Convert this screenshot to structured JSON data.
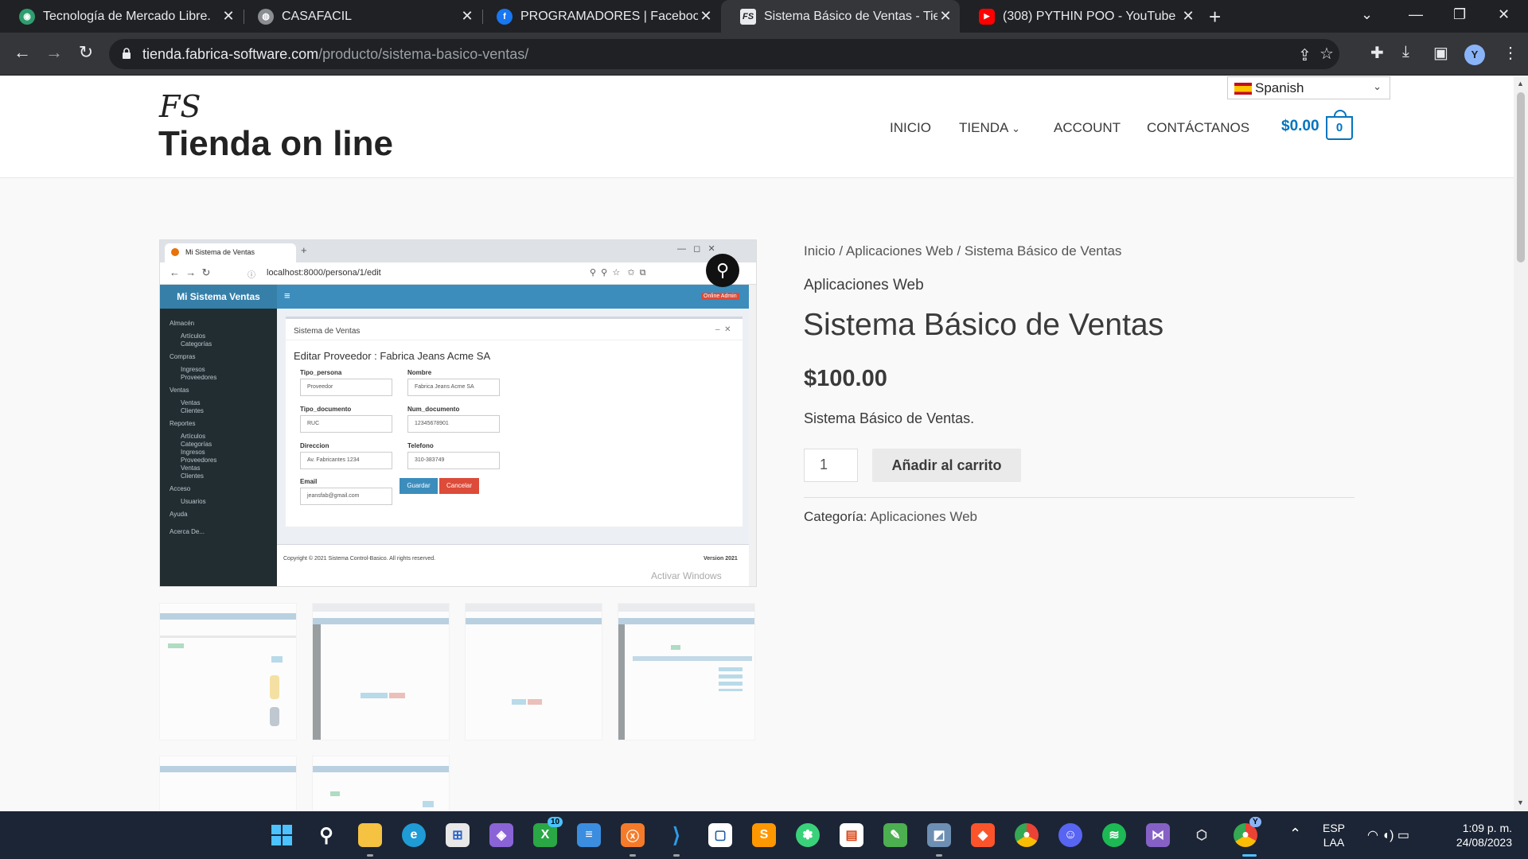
{
  "browser": {
    "tabs": [
      {
        "title": "Tecnología de Mercado Libre.",
        "icon": "globe-green-icon",
        "color": "#2e9e6e"
      },
      {
        "title": "CASAFACIL",
        "icon": "globe-icon",
        "color": "#8a8d91"
      },
      {
        "title": "PROGRAMADORES | Facebook",
        "icon": "facebook-icon",
        "color": "#1877f2"
      },
      {
        "title": "Sistema Básico de Ventas - Tiend",
        "icon": "fs-site-icon",
        "color": "#e8eaed"
      },
      {
        "title": "(308) PYTHIN POO - YouTube",
        "icon": "youtube-icon",
        "color": "#ff0000"
      }
    ],
    "url_host": "tienda.fabrica-software.com",
    "url_path": "/producto/sistema-basico-ventas/",
    "profile_initial": "Y"
  },
  "site": {
    "logo_text": "FS",
    "title": "Tienda on line",
    "language": "Spanish",
    "nav": [
      "INICIO",
      "TIENDA",
      "ACCOUNT",
      "CONTÁCTANOS"
    ],
    "cart_total": "$0.00",
    "cart_count": "0"
  },
  "screenshot": {
    "tab_title": "Mi Sistema de Ventas",
    "url": "localhost:8000/persona/1/edit",
    "brand": "Mi Sistema Ventas",
    "user": "Online Admin",
    "sidebar": [
      "Almacén",
      "Artículos",
      "Categorías",
      "Compras",
      "Ingresos",
      "Proveedores",
      "Ventas",
      "Ventas",
      "Clientes",
      "Reportes",
      "Artículos",
      "Categorías",
      "Ingresos",
      "Proveedores",
      "Ventas",
      "Clientes",
      "Acceso",
      "Usuarios",
      "Ayuda",
      "Acerca De..."
    ],
    "box_title": "Sistema de Ventas",
    "form_heading": "Editar Proveedor : Fabrica Jeans Acme SA",
    "fields": [
      {
        "label": "Tipo_persona",
        "value": "Proveedor"
      },
      {
        "label": "Nombre",
        "value": "Fabrica Jeans Acme SA"
      },
      {
        "label": "Tipo_documento",
        "value": "RUC"
      },
      {
        "label": "Num_documento",
        "value": "12345678901"
      },
      {
        "label": "Direccion",
        "value": "Av. Fabricantes 1234"
      },
      {
        "label": "Telefono",
        "value": "310-383749"
      },
      {
        "label": "Email",
        "value": "jeansfab@gmail.com"
      }
    ],
    "save": "Guardar",
    "cancel": "Cancelar",
    "copyright": "Copyright © 2021 Sistema Control-Basico. All rights reserved.",
    "version": "Version 2021",
    "watermark": "Activar Windows"
  },
  "product": {
    "breadcrumb": "Inicio / Aplicaciones Web / Sistema Básico de Ventas",
    "category_top": "Aplicaciones Web",
    "title": "Sistema Básico de Ventas",
    "price": "$100.00",
    "description": "Sistema Básico de Ventas.",
    "quantity": "1",
    "add_to_cart": "Añadir al carrito",
    "meta_label": "Categoría:",
    "meta_value": "Aplicaciones Web"
  },
  "taskbar": {
    "language": "ESP",
    "layout": "LAA",
    "time": "1:09 p. m.",
    "date": "24/08/2023",
    "xbox_badge": "10",
    "chrome_badge": "Y"
  }
}
